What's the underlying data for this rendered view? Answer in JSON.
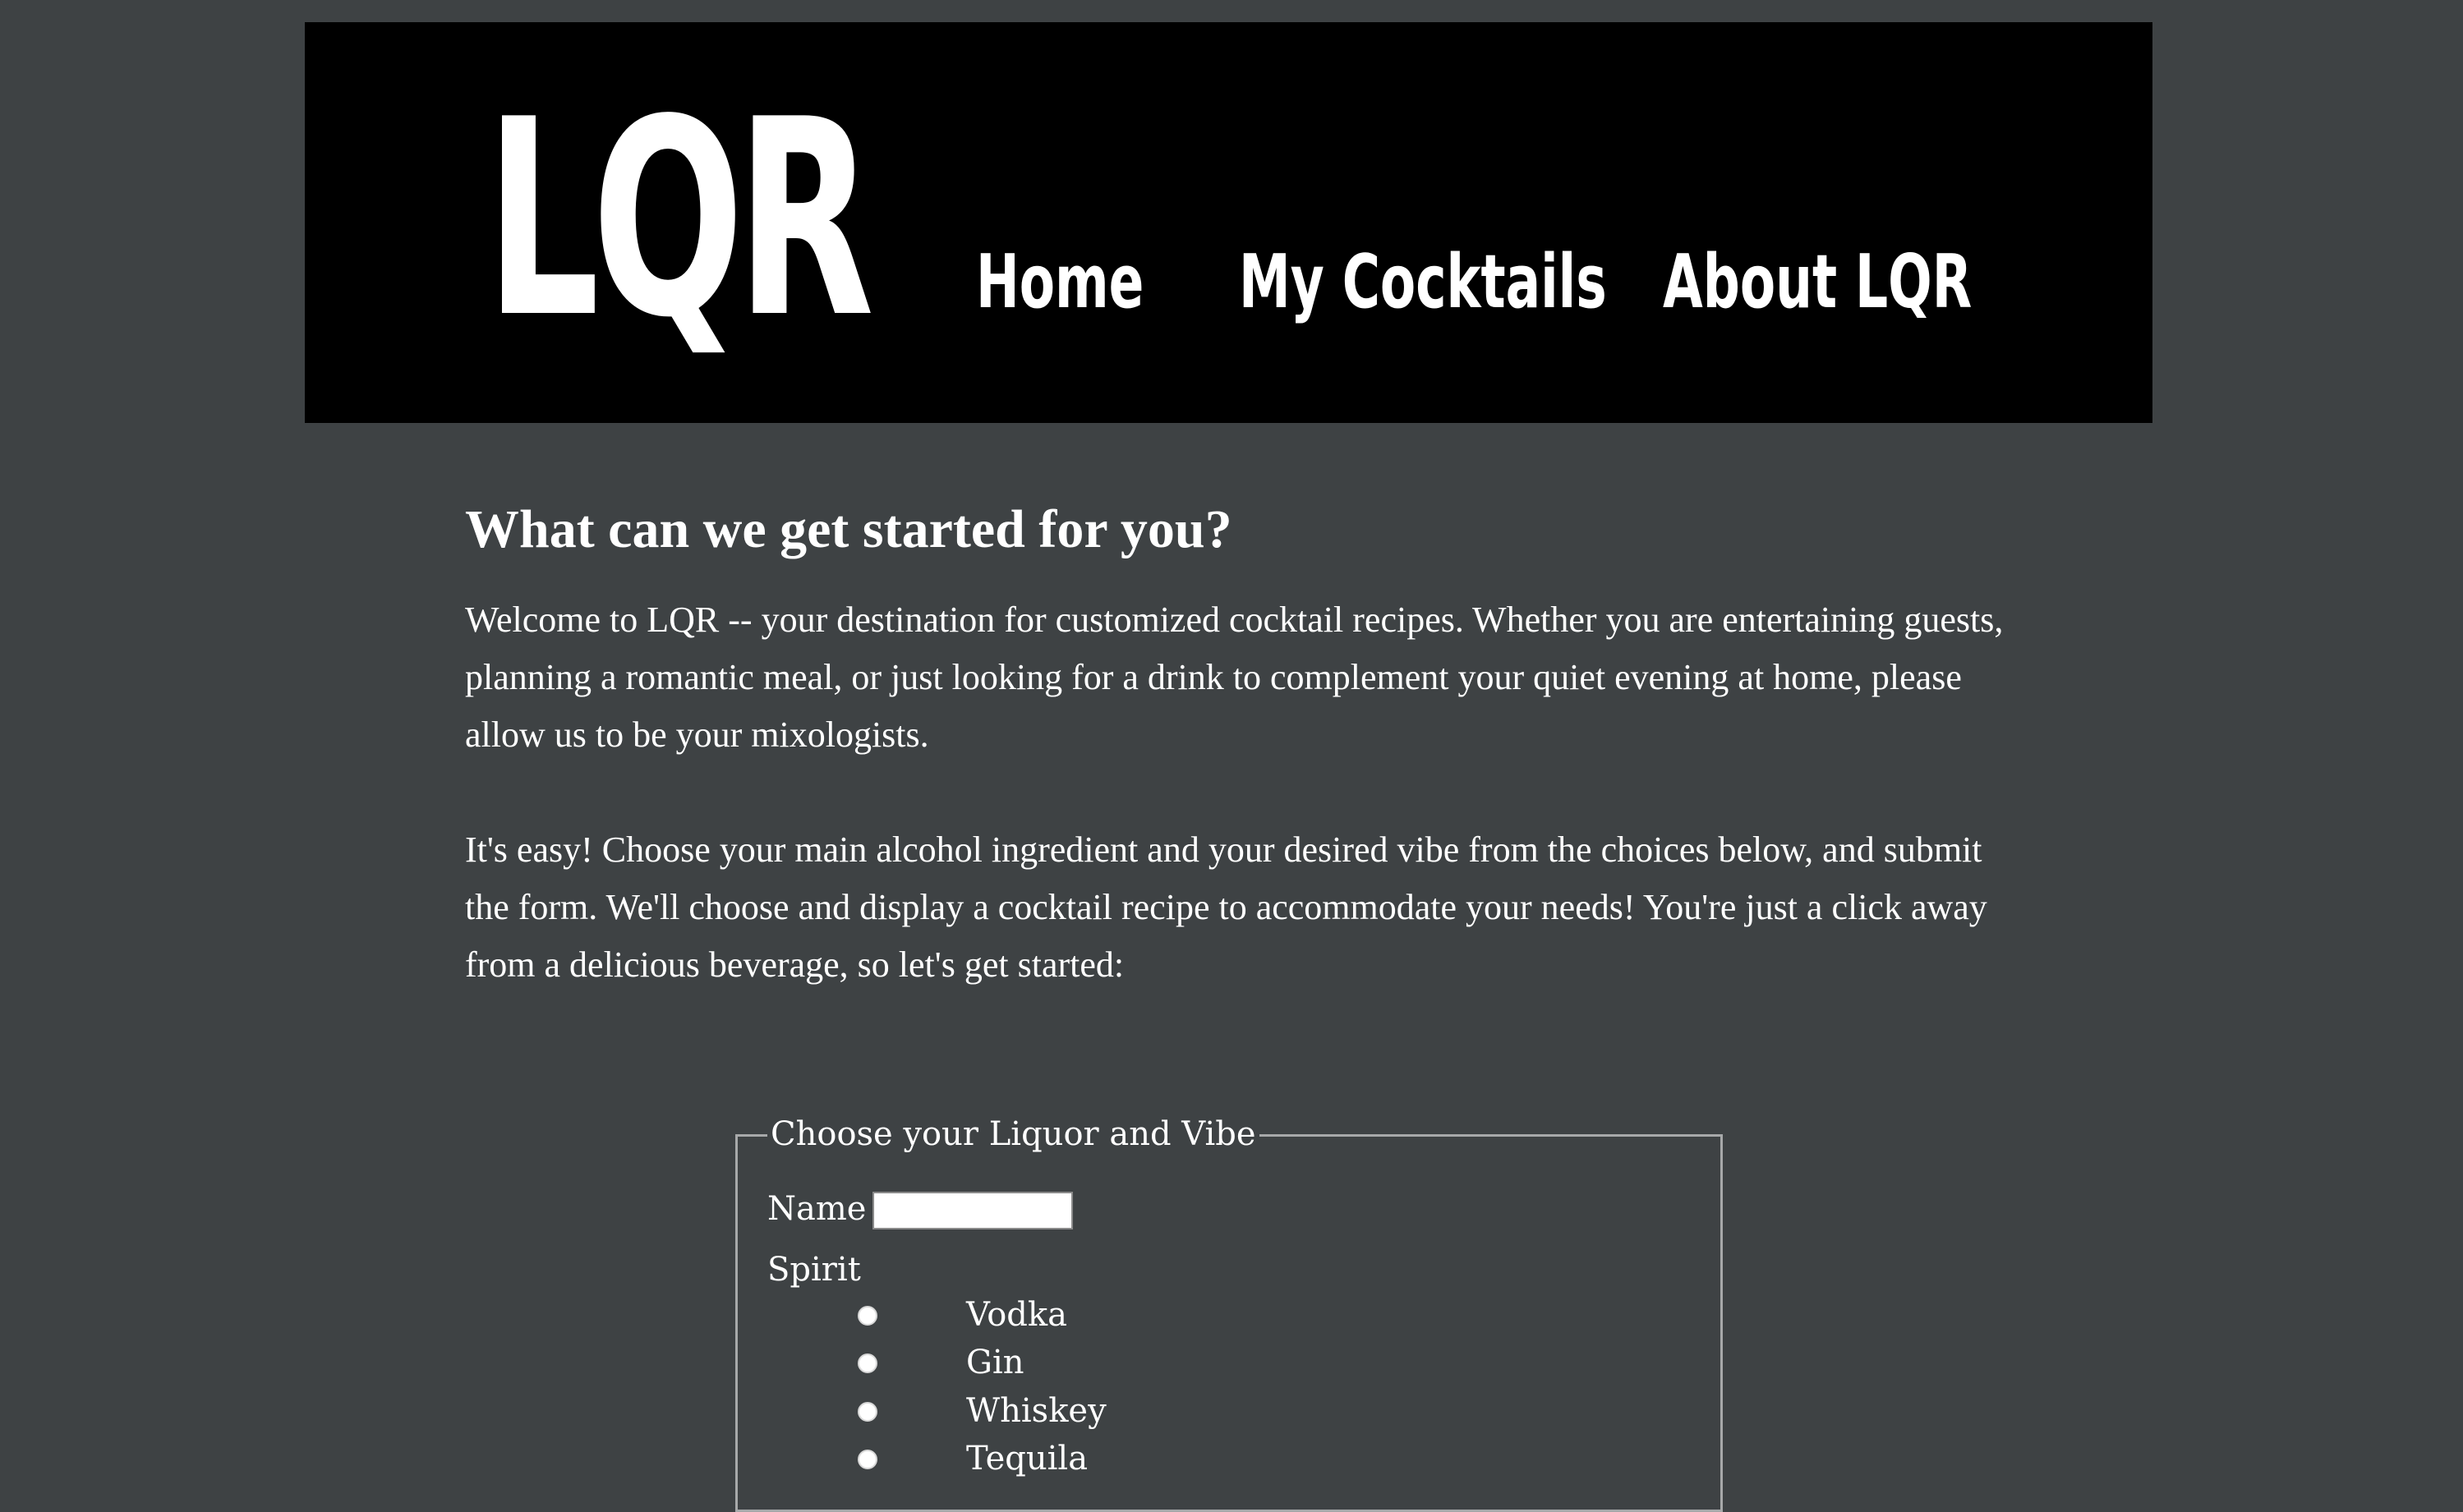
{
  "header": {
    "logo": "LQR",
    "nav": [
      {
        "label": "Home"
      },
      {
        "label": "My Cocktails"
      },
      {
        "label": "About LQR"
      }
    ]
  },
  "main": {
    "heading": "What can we get started for you?",
    "paragraphs": [
      "Welcome to LQR -- your destination for customized cocktail recipes. Whether you are entertaining guests, planning a romantic meal, or just looking for a drink to complement your quiet evening at home, please allow us to be your mixologists.",
      "It's easy! Choose your main alcohol ingredient and your desired vibe from the choices below, and submit the form. We'll choose and display a cocktail recipe to accommodate your needs! You're just a click away from a delicious beverage, so let's get started:"
    ]
  },
  "form": {
    "legend": "Choose your Liquor and Vibe",
    "name_label": "Name",
    "name_value": "",
    "spirit_label": "Spirit",
    "spirit_options": [
      "Vodka",
      "Gin",
      "Whiskey",
      "Tequila"
    ]
  },
  "colors": {
    "page_background": "#3e4244",
    "header_background": "#000000",
    "text": "#ffffff",
    "fieldset_border": "#a7a9aa"
  }
}
